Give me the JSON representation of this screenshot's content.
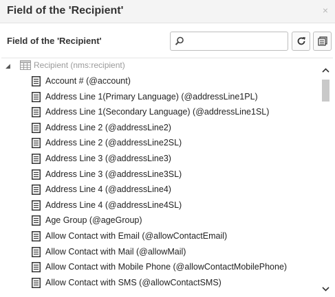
{
  "dialog": {
    "title": "Field of the 'Recipient'",
    "close_glyph": "×"
  },
  "toolbar": {
    "label": "Field of the 'Recipient'",
    "search": {
      "value": "",
      "placeholder": ""
    }
  },
  "tree": {
    "root": {
      "label": "Recipient (nms:recipient)",
      "expanded": true,
      "icon": "table-icon"
    },
    "items": [
      {
        "label": "Account # (@account)"
      },
      {
        "label": "Address Line 1(Primary Language) (@addressLine1PL)"
      },
      {
        "label": "Address Line 1(Secondary Language) (@addressLine1SL)"
      },
      {
        "label": "Address Line 2 (@addressLine2)"
      },
      {
        "label": "Address Line 2 (@addressLine2SL)"
      },
      {
        "label": "Address Line 3 (@addressLine3)"
      },
      {
        "label": "Address Line 3 (@addressLine3SL)"
      },
      {
        "label": "Address Line 4 (@addressLine4)"
      },
      {
        "label": "Address Line 4 (@addressLine4SL)"
      },
      {
        "label": "Age Group (@ageGroup)"
      },
      {
        "label": "Allow Contact with Email (@allowContactEmail)"
      },
      {
        "label": "Allow Contact with Mail (@allowMail)"
      },
      {
        "label": "Allow Contact with Mobile Phone (@allowContactMobilePhone)"
      },
      {
        "label": "Allow Contact with SMS (@allowContactSMS)"
      }
    ]
  },
  "icons": {
    "close": "close-icon",
    "search": "search-icon",
    "refresh": "refresh-icon",
    "details": "details-icon",
    "item": "document-icon",
    "root": "table-icon"
  },
  "colors": {
    "titlebar_bg": "#f4f4f4",
    "border": "#bdbdbd",
    "root_label": "#9a9a9a",
    "item_label": "#222222",
    "scroll_thumb": "#c9c9c9"
  }
}
